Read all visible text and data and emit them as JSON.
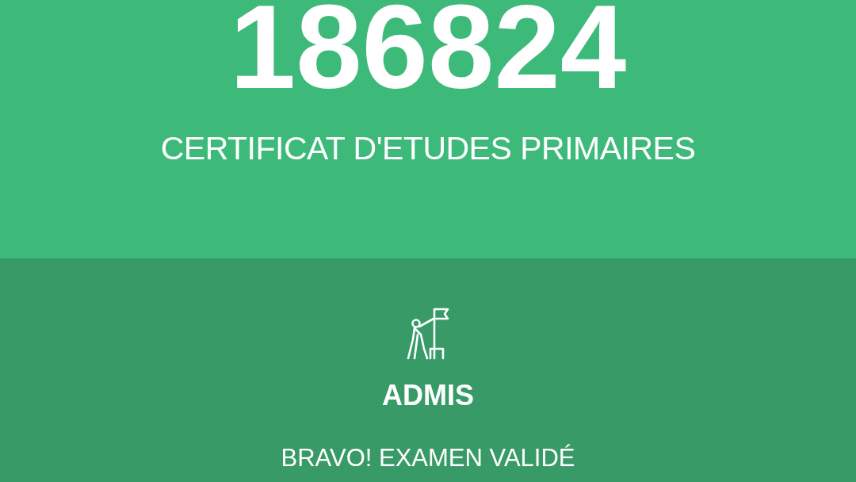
{
  "result_header": {
    "number": "186824",
    "exam": "CERTIFICAT D'ETUDES PRIMAIRES"
  },
  "result": {
    "status": "ADMIS",
    "message": "BRAVO! EXAMEN VALIDÉ",
    "passed": true
  }
}
